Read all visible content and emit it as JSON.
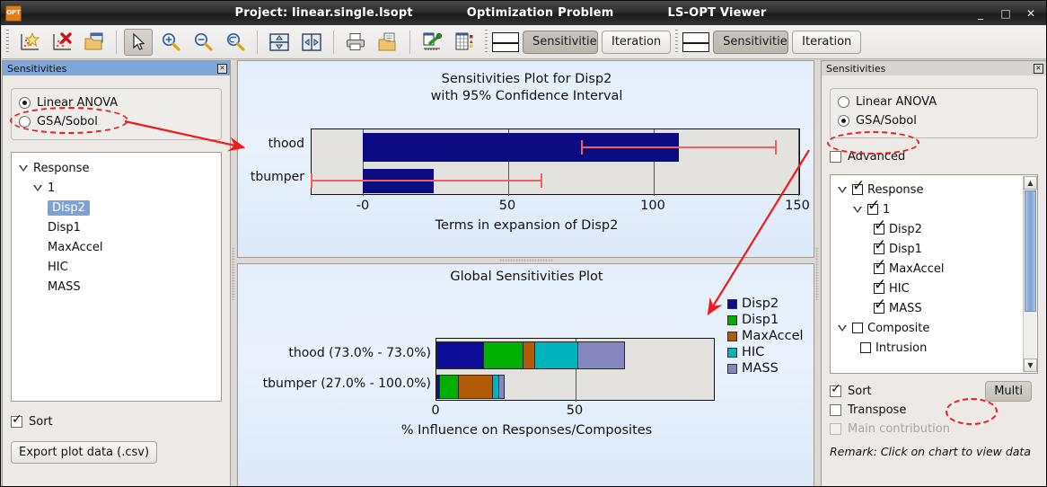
{
  "window": {
    "app_icon": "OPT",
    "project_title": "Project: linear.single.lsopt",
    "mode_title": "Optimization Problem",
    "app_title": "LS-OPT Viewer",
    "minimize": "_",
    "maximize": "□",
    "close": "✕"
  },
  "toolbar": {
    "icons": [
      {
        "name": "add-plot-icon",
        "glyph": "★"
      },
      {
        "name": "delete-plot-icon",
        "glyph": "✖"
      },
      {
        "name": "open-folder-icon",
        "glyph": "📂"
      },
      {
        "name": "pointer-select-icon",
        "glyph": "↖"
      },
      {
        "name": "zoom-in-icon",
        "glyph": "+"
      },
      {
        "name": "zoom-out-icon",
        "glyph": "−"
      },
      {
        "name": "zoom-reset-icon",
        "glyph": "↩"
      },
      {
        "name": "split-horizontal-icon",
        "glyph": "⇕"
      },
      {
        "name": "split-vertical-icon",
        "glyph": "⇔"
      },
      {
        "name": "print-icon",
        "glyph": "🖨"
      },
      {
        "name": "save-as-icon",
        "glyph": "💾"
      },
      {
        "name": "plot-settings-icon",
        "glyph": "🔧"
      },
      {
        "name": "table-view-icon",
        "glyph": "▦"
      }
    ],
    "left_group": {
      "view_icon": "split-view-icon",
      "sensitivities_label": "Sensitivities",
      "iteration_label": "Iteration",
      "selected": "Sensitivities"
    },
    "right_group": {
      "view_icon": "split-view-icon",
      "sensitivities_label": "Sensitivities",
      "iteration_label": "Iteration",
      "selected": "Sensitivities"
    }
  },
  "left_panel": {
    "title": "Sensitivities",
    "close_glyph": "✕",
    "method_options": [
      {
        "label": "Linear ANOVA",
        "selected": true
      },
      {
        "label": "GSA/Sobol",
        "selected": false
      }
    ],
    "tree": {
      "root": "Response",
      "child": "1",
      "leaves": [
        {
          "label": "Disp2",
          "selected": true
        },
        {
          "label": "Disp1",
          "selected": false
        },
        {
          "label": "MaxAccel",
          "selected": false
        },
        {
          "label": "HIC",
          "selected": false
        },
        {
          "label": "MASS",
          "selected": false
        }
      ]
    },
    "sort": {
      "label": "Sort",
      "checked": true
    },
    "export_button": "Export plot data (.csv)"
  },
  "right_panel": {
    "title": "Sensitivities",
    "close_glyph": "✕",
    "method_options": [
      {
        "label": "Linear ANOVA",
        "selected": false
      },
      {
        "label": "GSA/Sobol",
        "selected": true
      }
    ],
    "advanced": {
      "label": "Advanced",
      "checked": false
    },
    "tree": [
      {
        "label": "Response",
        "indent": 0,
        "expander": true,
        "checked": true
      },
      {
        "label": "1",
        "indent": 1,
        "expander": true,
        "checked": true
      },
      {
        "label": "Disp2",
        "indent": 2,
        "expander": false,
        "checked": true
      },
      {
        "label": "Disp1",
        "indent": 2,
        "expander": false,
        "checked": true
      },
      {
        "label": "MaxAccel",
        "indent": 2,
        "expander": false,
        "checked": true
      },
      {
        "label": "HIC",
        "indent": 2,
        "expander": false,
        "checked": true
      },
      {
        "label": "MASS",
        "indent": 2,
        "expander": false,
        "checked": true
      },
      {
        "label": "Composite",
        "indent": 0,
        "expander": true,
        "checked": false
      },
      {
        "label": "Intrusion",
        "indent": 1,
        "expander": false,
        "checked": false
      }
    ],
    "sort": {
      "label": "Sort",
      "checked": true
    },
    "transpose": {
      "label": "Transpose",
      "checked": false
    },
    "main_contribution": {
      "label": "Main contribution",
      "checked": false,
      "disabled": true
    },
    "multi_button": "Multi",
    "remark": "Remark: Click on chart to view data",
    "scroll_up_glyph": "▲",
    "scroll_down_glyph": "▼"
  },
  "chart_data": [
    {
      "type": "bar",
      "orientation": "horizontal",
      "title": "Sensitivities Plot for Disp2\nwith 95% Confidence Interval",
      "title_line1": "Sensitivities Plot for Disp2",
      "title_line2": "with 95% Confidence Interval",
      "xlabel": "Terms in expansion of Disp2",
      "ylabel": "",
      "categories": [
        "thood",
        "tbumper"
      ],
      "values": [
        108.5,
        24.5
      ],
      "error_low": [
        75.0,
        -18.5
      ],
      "error_high": [
        142.0,
        61.5
      ],
      "xlim": [
        -25,
        152
      ],
      "xticks": [
        0,
        50,
        100,
        150
      ],
      "xtick_labels": [
        "-0",
        "50",
        "100",
        "150"
      ],
      "grid": true,
      "bar_color": "#0c0c82",
      "error_color": "#f4605f",
      "plot_bg": "#e4e2df"
    },
    {
      "type": "bar",
      "subtype": "stacked",
      "orientation": "horizontal",
      "title": "Global Sensitivities Plot",
      "xlabel": "% Influence on Responses/Composites",
      "ylabel": "",
      "categories": [
        "thood (73.0% - 73.0%)",
        "tbumper (27.0% - 100.0%)"
      ],
      "series": [
        {
          "name": "Disp2",
          "color": "#0c0c99",
          "values": [
            17.0,
            0.0
          ]
        },
        {
          "name": "Disp1",
          "color": "#00b000",
          "values": [
            14.2,
            4.5
          ]
        },
        {
          "name": "MaxAccel",
          "color": "#b35a06",
          "values": [
            4.4,
            12.5
          ]
        },
        {
          "name": "HIC",
          "color": "#00b4bf",
          "values": [
            15.5,
            1.6
          ]
        },
        {
          "name": "MASS",
          "color": "#8787bf",
          "values": [
            16.9,
            0.9
          ]
        }
      ],
      "xlim": [
        0,
        100
      ],
      "xticks": [
        0,
        50
      ],
      "xtick_labels": [
        "0",
        "50"
      ],
      "legend_position": "right",
      "legend_entries": [
        "Disp2",
        "Disp1",
        "MaxAccel",
        "HIC",
        "MASS"
      ],
      "grid": true,
      "plot_bg": "#e4e2df"
    }
  ],
  "annotations": {
    "color": "#ee1c1c",
    "ellipse_left_label": "Linear ANOVA",
    "ellipse_right_label": "GSA/Sobol",
    "ellipse_multi_label": "Multi"
  }
}
